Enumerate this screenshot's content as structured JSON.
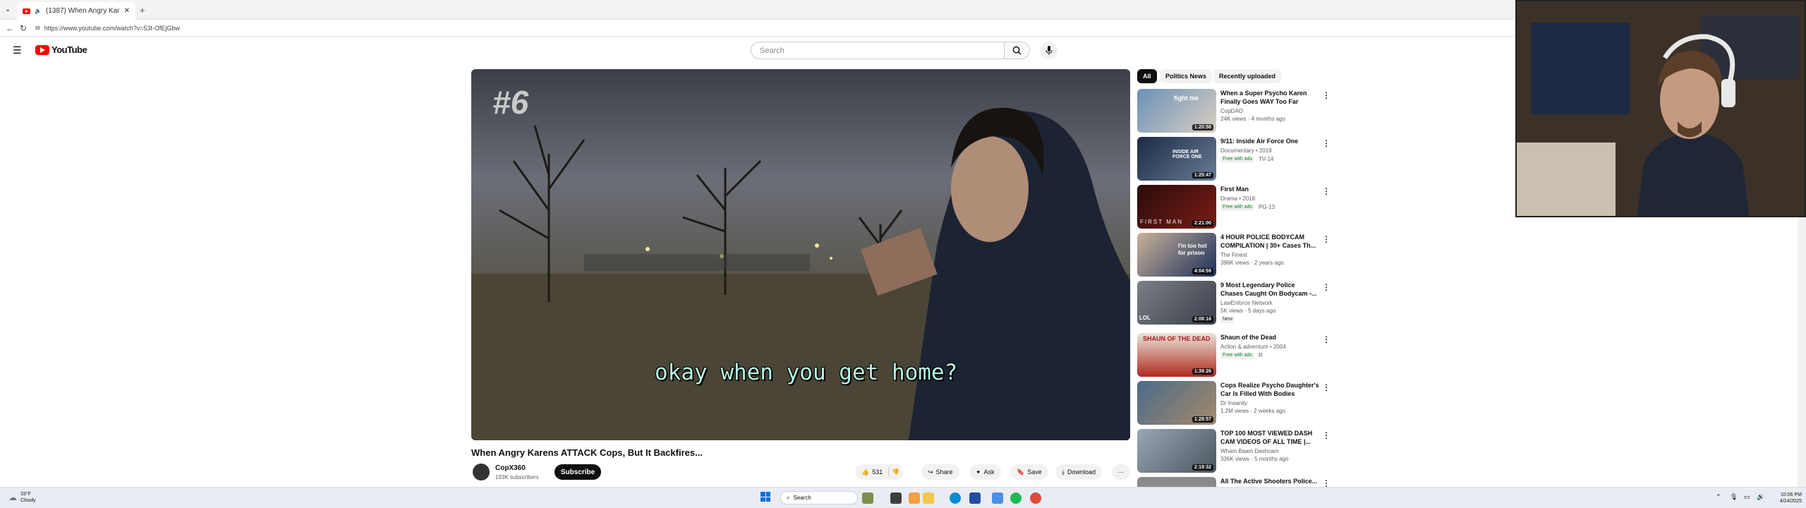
{
  "browser": {
    "tab_title": "(1387) When Angry Karens A",
    "url": "https://www.youtube.com/watch?v=53t-OfEjGbw"
  },
  "youtube": {
    "logo": "YouTube",
    "search_placeholder": "Search"
  },
  "video": {
    "overlay_rank": "#6",
    "caption": "okay when you get home?",
    "title": "When Angry Karens ATTACK Cops, But It Backfires...",
    "channel": "CopX360",
    "subscribers": "193K subscribers",
    "subscribe_label": "Subscribe",
    "likes": "531",
    "share_label": "Share",
    "ask_label": "Ask",
    "save_label": "Save",
    "download_label": "Download"
  },
  "chips": [
    "All",
    "Politics News",
    "Recently uploaded"
  ],
  "recommendations": [
    {
      "title": "When a Super Psycho Karen Finally Goes WAY Too Far",
      "channel": "CopDAO",
      "meta": "24K views · 4 months ago",
      "duration": "1:20:58",
      "thumb_text": "fight me"
    },
    {
      "title": "9/11: Inside Air Force One",
      "channel": "Documentary • 2019",
      "meta": "",
      "duration": "1:25:47",
      "badge": "Free with ads",
      "rating": "TV-14",
      "thumb_text": "INSIDE AIR FORCE ONE"
    },
    {
      "title": "First Man",
      "channel": "Drama • 2018",
      "meta": "",
      "duration": "2:21:00",
      "badge": "Free with ads",
      "rating": "PG-13",
      "thumb_text": "FIRST MAN"
    },
    {
      "title": "4 HOUR POLICE BODYCAM COMPILATION | 30+ Cases Th...",
      "channel": "The Finest",
      "meta": "398K views · 2 years ago",
      "duration": "4:04:59",
      "thumb_text": "I'm too hot for prison"
    },
    {
      "title": "9 Most Legendary Police Chases Caught On Bodycam -...",
      "channel": "LawEnforce Network",
      "meta": "5K views · 5 days ago",
      "duration": "2:08:16",
      "badge": "New",
      "thumb_text": "LOL"
    },
    {
      "title": "Shaun of the Dead",
      "channel": "Action & adventure • 2004",
      "meta": "",
      "duration": "1:39:26",
      "badge": "Free with ads",
      "rating": "R",
      "thumb_text": "SHAUN OF THE DEAD"
    },
    {
      "title": "Cops Realize Psycho Daughter's Car Is Filled With Bodies",
      "channel": "Dr Insanity",
      "meta": "1.2M views · 2 weeks ago",
      "duration": "1:29:57",
      "thumb_text": ""
    },
    {
      "title": "TOP 100 MOST VIEWED DASH CAM VIDEOS OF ALL TIME |...",
      "channel": "Wham Baam Dashcam",
      "meta": "336K views · 5 months ago",
      "duration": "2:19:32",
      "thumb_text": ""
    },
    {
      "title": "All The Active Shooters Police...",
      "channel": "",
      "meta": "",
      "duration": "",
      "thumb_text": ""
    }
  ],
  "taskbar": {
    "weather_temp": "33°F",
    "weather_desc": "Cloudy",
    "search_label": "Search",
    "time": "10:06 PM",
    "date": "4/24/2025"
  },
  "colors": {
    "youtube_red": "#ff0000",
    "taskbar_bg": "#e9edf3",
    "caption_text": "#b8f5e4"
  }
}
